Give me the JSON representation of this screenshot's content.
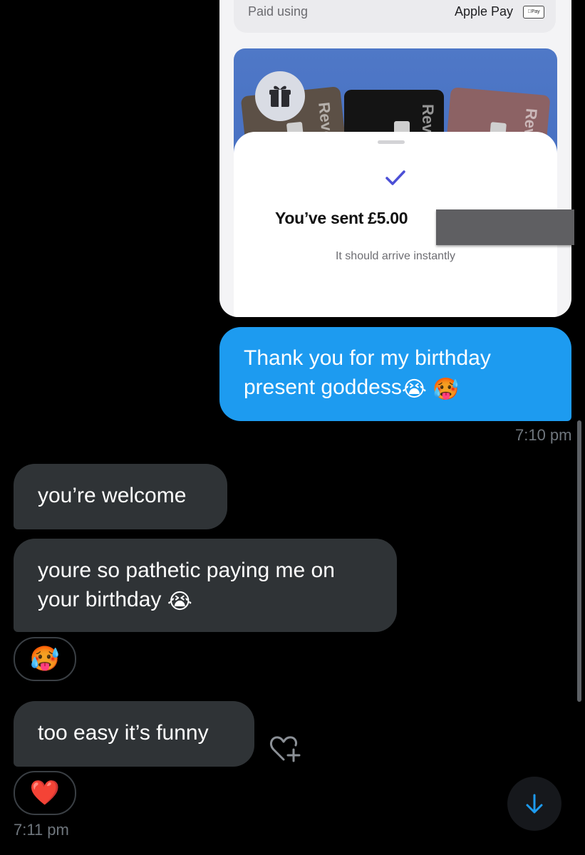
{
  "screenshot": {
    "paid_label": "Paid using",
    "paid_value": "Apple Pay",
    "apple_pay_badge": "Pay",
    "card_text": "Revo",
    "sent_text": "You’ve sent £5.00",
    "sub_text": "It should arrive instantly"
  },
  "messages": {
    "outgoing_1": {
      "text": "Thank you for my birthday present goddess",
      "emojis": "😭 🥵",
      "time": "7:10 pm"
    },
    "incoming_1": {
      "text": "you’re welcome"
    },
    "incoming_2": {
      "text": "youre so pathetic paying me on your birthday",
      "emoji": "😭",
      "reaction": "🥵"
    },
    "incoming_3": {
      "text": "too easy it’s funny",
      "reaction": "❤️",
      "time": "7:11 pm"
    }
  },
  "icons": {
    "checkmark": "check-icon",
    "gift": "gift-icon",
    "react": "heart-plus-icon",
    "scroll_down": "arrow-down-icon"
  },
  "colors": {
    "outgoing_bubble": "#1d9bf0",
    "incoming_bubble": "#2f3336",
    "check": "#4b4fd6",
    "accent_arrow": "#1d9bf0"
  }
}
